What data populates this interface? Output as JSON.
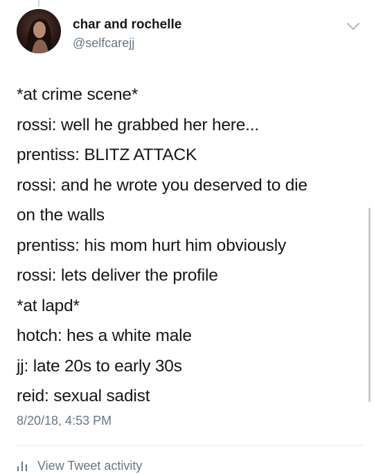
{
  "tweet": {
    "display_name": "char and rochelle",
    "handle": "@selfcarejj",
    "lines": [
      "*at crime scene*",
      "rossi: well he grabbed her here...",
      "prentiss: BLITZ ATTACK",
      "rossi: and he wrote you deserved to die",
      "on the walls",
      "prentiss: his mom hurt him obviously",
      "rossi: lets deliver the profile",
      "*at lapd*",
      "hotch: hes a white male",
      "jj: late 20s to early 30s",
      "reid: sexual sadist"
    ],
    "timestamp": "8/20/18, 4:53 PM",
    "activity_label": "View Tweet activity"
  },
  "icons": {
    "menu": "chevron-down-icon",
    "activity": "bar-chart-icon"
  },
  "colors": {
    "text_primary": "#14171a",
    "text_secondary": "#657786",
    "divider": "#e1e8ed"
  }
}
